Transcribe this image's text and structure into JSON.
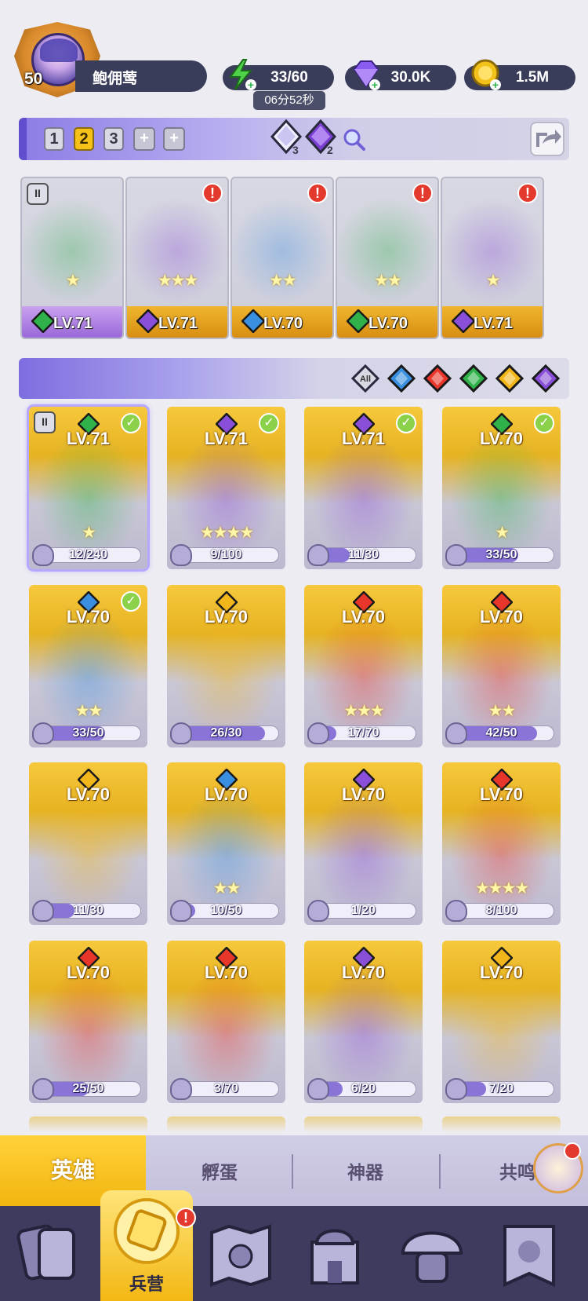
{
  "player": {
    "level": "50",
    "name": "鲍佣莺"
  },
  "resources": {
    "energy": {
      "value": "33/60",
      "timer": "06分52秒",
      "icon": "lightning-icon",
      "color": "#4fd14a"
    },
    "gems": {
      "value": "30.0K",
      "icon": "gem-icon",
      "color": "#8a5cf0"
    },
    "gold": {
      "value": "1.5M",
      "icon": "coin-icon",
      "color": "#f2c21a"
    }
  },
  "team_bar": {
    "tabs": [
      "1",
      "2",
      "3"
    ],
    "active_tab": "2",
    "add_buttons": [
      "+",
      "+"
    ],
    "counters": [
      {
        "icon": "white-gem-icon",
        "value": "3"
      },
      {
        "icon": "purple-gem-icon",
        "value": "2"
      }
    ],
    "search_icon": "magnifier-icon",
    "share_icon": "share-icon"
  },
  "team_slots": [
    {
      "level": "LV.71",
      "element": "green",
      "stars": "★",
      "footer": "purple",
      "lock": "II",
      "alert": false
    },
    {
      "level": "LV.71",
      "element": "purple",
      "stars": "★★★",
      "footer": "gold",
      "lock": "",
      "alert": true
    },
    {
      "level": "LV.70",
      "element": "blue",
      "stars": "★★",
      "footer": "gold",
      "lock": "",
      "alert": true
    },
    {
      "level": "LV.70",
      "element": "green",
      "stars": "★★",
      "footer": "gold",
      "lock": "",
      "alert": true
    },
    {
      "level": "LV.71",
      "element": "purple",
      "stars": "★",
      "footer": "gold",
      "lock": "",
      "alert": true
    }
  ],
  "filters": {
    "all_label": "All",
    "elements": [
      {
        "name": "water",
        "color": "#3a8fe0"
      },
      {
        "name": "fire",
        "color": "#e8362a"
      },
      {
        "name": "nature",
        "color": "#2fb24a"
      },
      {
        "name": "light",
        "color": "#f2b61a"
      },
      {
        "name": "dark",
        "color": "#8a4fd8"
      }
    ]
  },
  "heroes": [
    {
      "level": "LV.71",
      "element": "green",
      "progress": "12/240",
      "fill": 0.05,
      "check": true,
      "stars": "★",
      "selected": true,
      "lock": "II"
    },
    {
      "level": "LV.71",
      "element": "purple",
      "progress": "9/100",
      "fill": 0.09,
      "check": true,
      "stars": "★★★★",
      "selected": false,
      "lock": ""
    },
    {
      "level": "LV.71",
      "element": "purple",
      "progress": "11/30",
      "fill": 0.37,
      "check": true,
      "stars": "",
      "selected": false,
      "lock": ""
    },
    {
      "level": "LV.70",
      "element": "green",
      "progress": "33/50",
      "fill": 0.66,
      "check": true,
      "stars": "★",
      "selected": false,
      "lock": ""
    },
    {
      "level": "LV.70",
      "element": "blue",
      "progress": "33/50",
      "fill": 0.66,
      "check": true,
      "stars": "★★",
      "selected": false,
      "lock": ""
    },
    {
      "level": "LV.70",
      "element": "gold",
      "progress": "26/30",
      "fill": 0.87,
      "check": false,
      "stars": "",
      "selected": false,
      "lock": ""
    },
    {
      "level": "LV.70",
      "element": "red",
      "progress": "17/70",
      "fill": 0.24,
      "check": false,
      "stars": "★★★",
      "selected": false,
      "lock": ""
    },
    {
      "level": "LV.70",
      "element": "red",
      "progress": "42/50",
      "fill": 0.84,
      "check": false,
      "stars": "★★",
      "selected": false,
      "lock": ""
    },
    {
      "level": "LV.70",
      "element": "gold",
      "progress": "11/30",
      "fill": 0.37,
      "check": false,
      "stars": "",
      "selected": false,
      "lock": ""
    },
    {
      "level": "LV.70",
      "element": "blue",
      "progress": "10/50",
      "fill": 0.2,
      "check": false,
      "stars": "★★",
      "selected": false,
      "lock": ""
    },
    {
      "level": "LV.70",
      "element": "purple",
      "progress": "1/20",
      "fill": 0.05,
      "check": false,
      "stars": "",
      "selected": false,
      "lock": ""
    },
    {
      "level": "LV.70",
      "element": "red",
      "progress": "8/100",
      "fill": 0.08,
      "check": false,
      "stars": "★★★★",
      "selected": false,
      "lock": ""
    },
    {
      "level": "LV.70",
      "element": "red",
      "progress": "25/50",
      "fill": 0.5,
      "check": false,
      "stars": "",
      "selected": false,
      "lock": ""
    },
    {
      "level": "LV.70",
      "element": "red",
      "progress": "3/70",
      "fill": 0.04,
      "check": false,
      "stars": "",
      "selected": false,
      "lock": ""
    },
    {
      "level": "LV.70",
      "element": "purple",
      "progress": "6/20",
      "fill": 0.3,
      "check": false,
      "stars": "",
      "selected": false,
      "lock": ""
    },
    {
      "level": "LV.70",
      "element": "gold",
      "progress": "7/20",
      "fill": 0.35,
      "check": false,
      "stars": "",
      "selected": false,
      "lock": ""
    }
  ],
  "subtabs": {
    "active": "英雄",
    "items": [
      "孵蛋",
      "神器",
      "共鸣"
    ]
  },
  "bottom_nav": {
    "active_label": "兵营",
    "items": [
      "cards-icon",
      "barracks-icon",
      "map-icon",
      "castle-icon",
      "mushroom-house-icon",
      "banner-icon"
    ]
  },
  "colors": {
    "element_green": "#2fb24a",
    "element_purple": "#8a4fd8",
    "element_blue": "#3a8fe0",
    "element_red": "#e8362a",
    "element_gold": "#f2b61a",
    "accent": "#f2b50f"
  }
}
